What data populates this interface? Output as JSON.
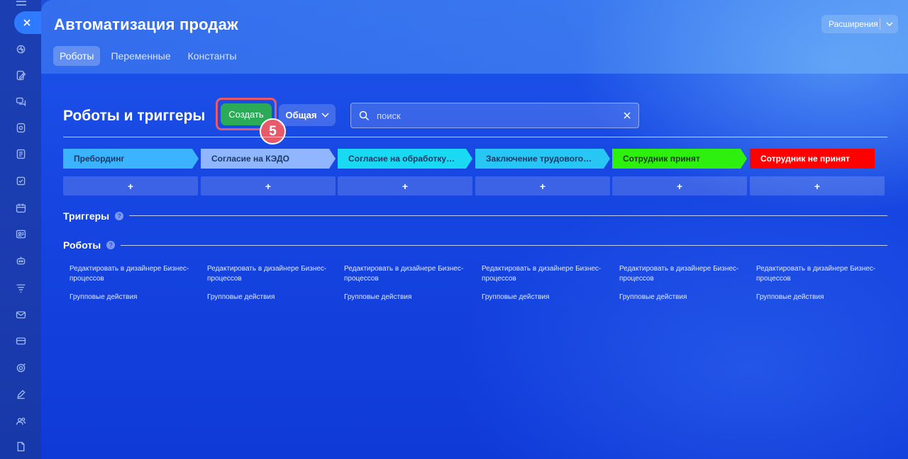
{
  "page": {
    "title": "Автоматизация продаж",
    "extensions_label": "Расширения",
    "tabs": [
      {
        "label": "Роботы",
        "active": true
      },
      {
        "label": "Переменные",
        "active": false
      },
      {
        "label": "Константы",
        "active": false
      }
    ]
  },
  "toolbar": {
    "section_title": "Роботы и триггеры",
    "create_label": "Создать",
    "step_badge": "5",
    "general_label": "Общая",
    "search_placeholder": "поиск"
  },
  "stages": [
    {
      "label": "Пребординг",
      "color": "#3bb3ff",
      "text_color": "#1a3a66"
    },
    {
      "label": "Согласие на КЭДО",
      "color": "#8fb6ff",
      "text_color": "#1a3a66"
    },
    {
      "label": "Согласие на обработку ПД",
      "color": "#19d9f3",
      "text_color": "#1a3a66"
    },
    {
      "label": "Заключение трудового дог...",
      "color": "#27c6f5",
      "text_color": "#1a3a66"
    },
    {
      "label": "Сотрудник принят",
      "color": "#2df00f",
      "text_color": "#1a3a1a"
    },
    {
      "label": "Сотрудник не принят",
      "color": "#ff0000",
      "text_color": "#ffffff"
    }
  ],
  "add_label": "+",
  "triggers": {
    "title": "Триггеры",
    "help": "?"
  },
  "robots": {
    "title": "Роботы",
    "help": "?",
    "columns": [
      {
        "edit": "Редактировать в дизайнере Бизнес-процессов",
        "group": "Групповые действия"
      },
      {
        "edit": "Редактировать в дизайнере Бизнес-процессов",
        "group": "Групповые действия"
      },
      {
        "edit": "Редактировать в дизайнере Бизнес-процессов",
        "group": "Групповые действия"
      },
      {
        "edit": "Редактировать в дизайнере Бизнес-процессов",
        "group": "Групповые действия"
      },
      {
        "edit": "Редактировать в дизайнере Бизнес-процессов",
        "group": "Групповые действия"
      },
      {
        "edit": "Редактировать в дизайнере Бизнес-процессов",
        "group": "Групповые действия"
      }
    ]
  },
  "icons": {
    "rail": [
      "menu-icon",
      "close-icon",
      "activity-icon",
      "task-edit-icon",
      "chat-icon",
      "storage-icon",
      "document-icon",
      "checklist-icon",
      "calendar-icon",
      "contact-card-icon",
      "robot-icon",
      "filter-icon",
      "mail-icon",
      "card-icon",
      "target-icon",
      "pen-icon",
      "users-icon",
      "file-icon"
    ]
  },
  "colors": {
    "accent_create": "#2bab58",
    "highlight": "#e8596a"
  }
}
